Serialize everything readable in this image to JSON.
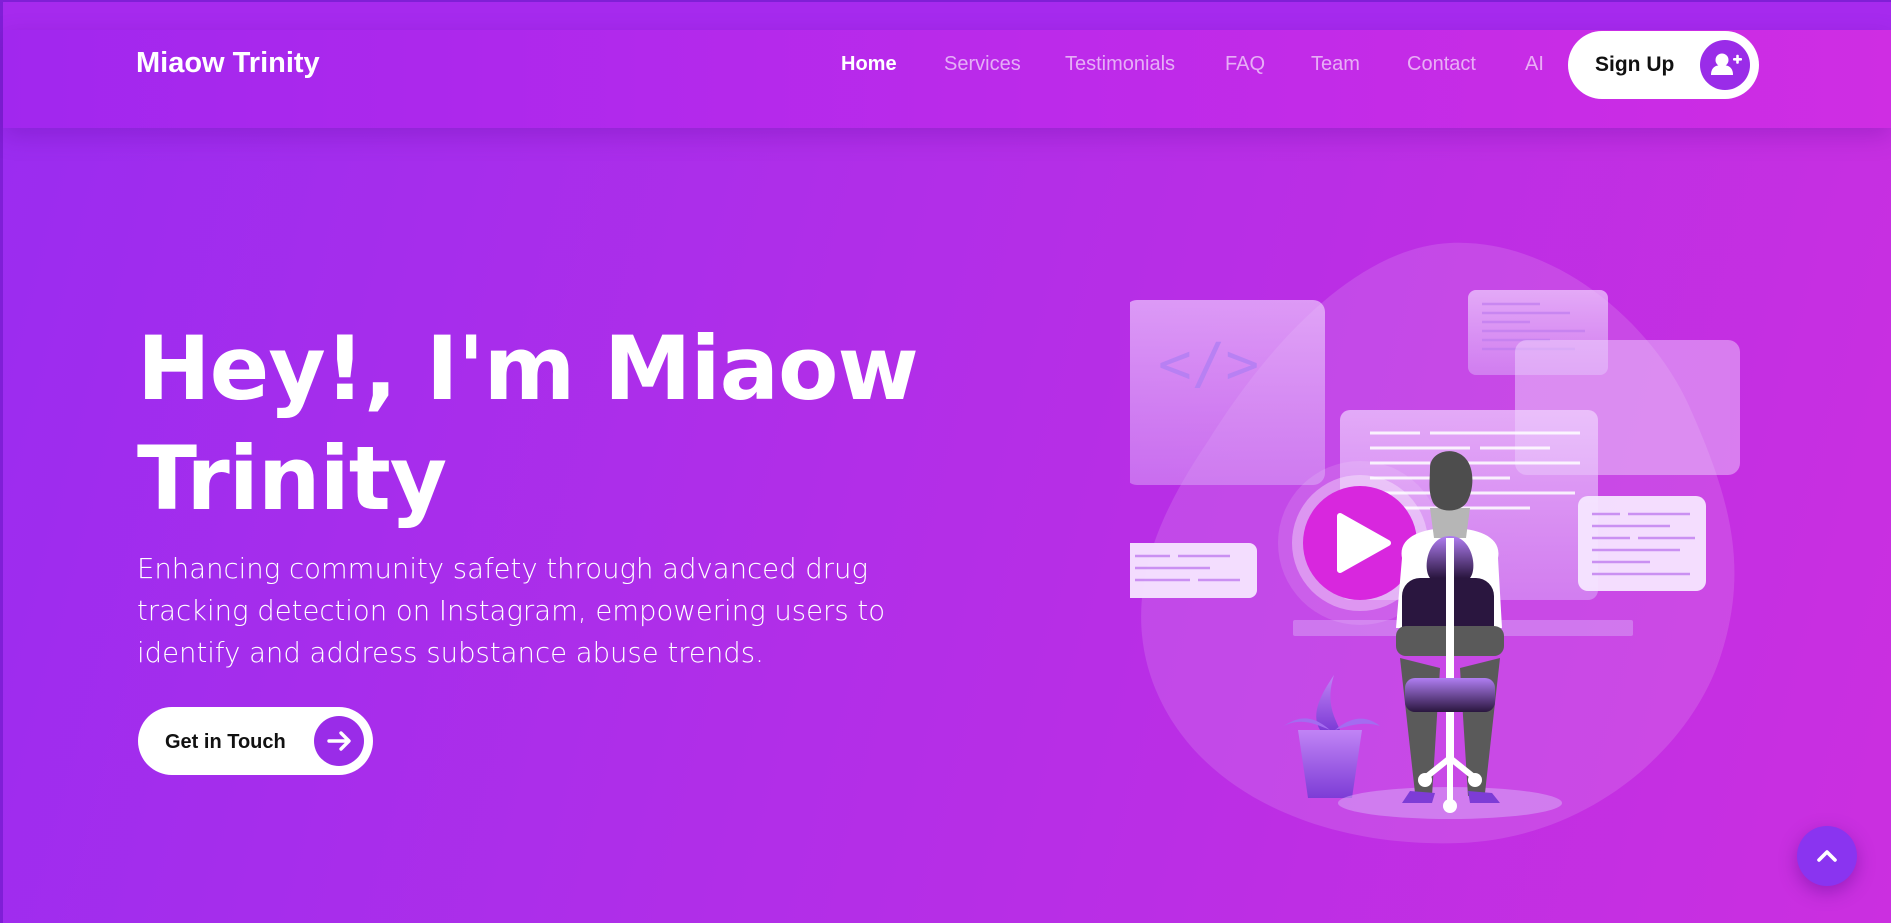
{
  "brand": {
    "name": "Miaow Trinity"
  },
  "nav": {
    "items": [
      {
        "label": "Home",
        "active": true
      },
      {
        "label": "Services",
        "active": false
      },
      {
        "label": "Testimonials",
        "active": false
      },
      {
        "label": "FAQ",
        "active": false
      },
      {
        "label": "Team",
        "active": false
      },
      {
        "label": "Contact",
        "active": false
      },
      {
        "label": "AI",
        "active": false
      }
    ],
    "signup_label": "Sign Up",
    "signup_icon": "user-plus-icon"
  },
  "hero": {
    "title_line1": "Hey!, I'm Miaow",
    "title_line2": "Trinity",
    "subtitle": "Enhancing community safety through advanced drug tracking detection on Instagram, empowering users to identify and address substance abuse trends.",
    "cta_label": "Get in Touch",
    "cta_icon": "arrow-right-icon",
    "illustration": {
      "code_symbol": "</>",
      "play_icon": "play-icon"
    }
  },
  "scroll_top": {
    "icon": "chevron-up-icon"
  },
  "colors": {
    "accent": "#9a2ce8",
    "gradient_start": "#9a2cf0",
    "gradient_end": "#cb2fe0",
    "button_bg": "#ffffff"
  }
}
